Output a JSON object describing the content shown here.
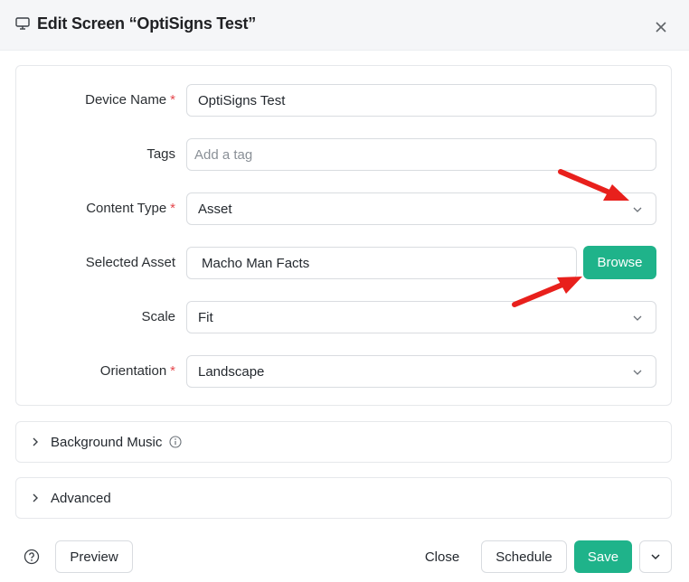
{
  "header": {
    "title": "Edit Screen  “OptiSigns Test”"
  },
  "form": {
    "device_name": {
      "label": "Device Name",
      "required_mark": "*",
      "value": "OptiSigns Test"
    },
    "tags": {
      "label": "Tags",
      "placeholder": "Add a tag"
    },
    "content_type": {
      "label": "Content Type",
      "required_mark": "*",
      "value": "Asset"
    },
    "selected_asset": {
      "label": "Selected Asset",
      "value": "Macho Man Facts",
      "browse_label": "Browse"
    },
    "scale": {
      "label": "Scale",
      "value": "Fit"
    },
    "orientation": {
      "label": "Orientation",
      "required_mark": "*",
      "value": "Landscape"
    }
  },
  "sections": {
    "background_music": "Background Music",
    "advanced": "Advanced"
  },
  "footer": {
    "preview_label": "Preview",
    "close_label": "Close",
    "schedule_label": "Schedule",
    "save_label": "Save"
  },
  "colors": {
    "accent": "#1fb38a",
    "required": "#e5484d",
    "annotation_arrow": "#e8201c"
  },
  "icons": {
    "title_icon": "monitor-icon",
    "close": "close-icon",
    "dropdown": "chevron-down-icon",
    "expand": "chevron-right-icon",
    "info": "info-icon",
    "help": "help-circle-icon"
  }
}
